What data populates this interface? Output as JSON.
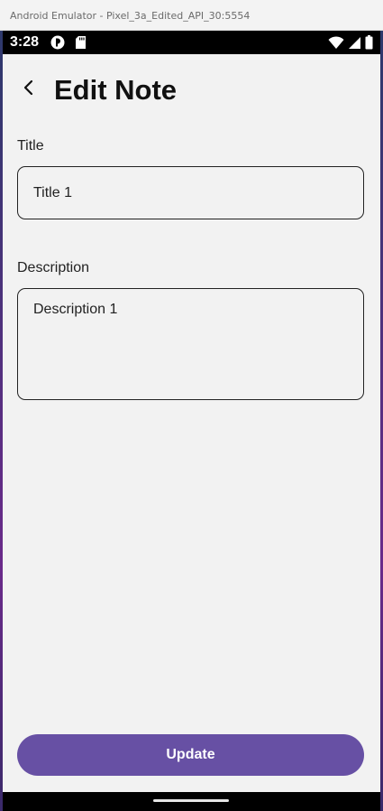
{
  "window": {
    "title": "Android Emulator - Pixel_3a_Edited_API_30:5554"
  },
  "statusbar": {
    "time": "3:28",
    "icons_left": [
      "app-notification-icon",
      "sd-card-icon"
    ],
    "icons_right": [
      "wifi-icon",
      "cell-signal-icon",
      "battery-icon"
    ]
  },
  "header": {
    "back_icon": "back-arrow-icon",
    "title": "Edit Note"
  },
  "form": {
    "title_label": "Title",
    "title_value": "Title 1",
    "description_label": "Description",
    "description_value": "Description 1"
  },
  "actions": {
    "update_label": "Update"
  },
  "colors": {
    "accent": "#6750a4",
    "background": "#f2f2f2"
  }
}
